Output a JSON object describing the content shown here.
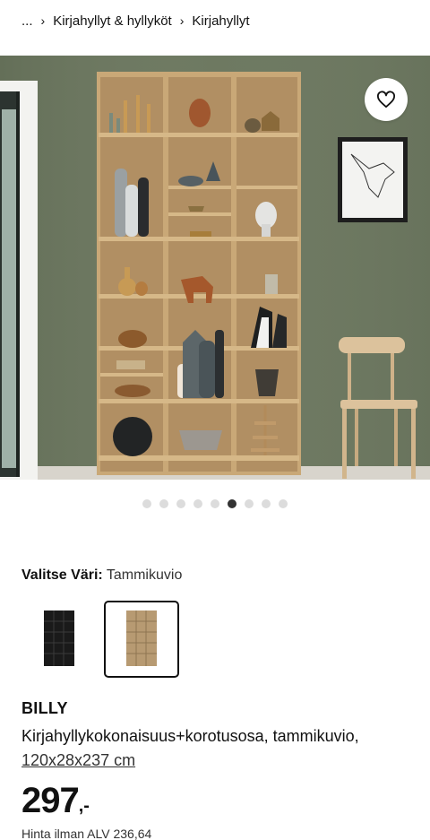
{
  "breadcrumb": {
    "items": [
      "...",
      "Kirjahyllyt & hyllyköt",
      "Kirjahyllyt"
    ],
    "separator": "›"
  },
  "gallery": {
    "image_alt": "BILLY bookcase in oak effect with decorative objects",
    "favourite_icon": "heart-icon",
    "dot_count": 9,
    "active_dot_index": 5
  },
  "color_picker": {
    "label": "Valitse Väri:",
    "selected_value": "Tammikuvio",
    "swatches": [
      {
        "name": "black-brown",
        "color": "#1c1c1c",
        "selected": false
      },
      {
        "name": "oak-effect",
        "color": "#b79a72",
        "selected": true
      }
    ]
  },
  "product": {
    "name": "BILLY",
    "description": "Kirjahyllykokonaisuus+korotusosa, tammikuvio,",
    "size_link": "120x28x237 cm"
  },
  "price": {
    "integer": "297",
    "suffix": ",-",
    "vat_text": "Hinta ilman ALV 236,64"
  },
  "colors": {
    "wall": "#6f7a63",
    "wood": "#cfae80",
    "accent_text": "#111111"
  }
}
